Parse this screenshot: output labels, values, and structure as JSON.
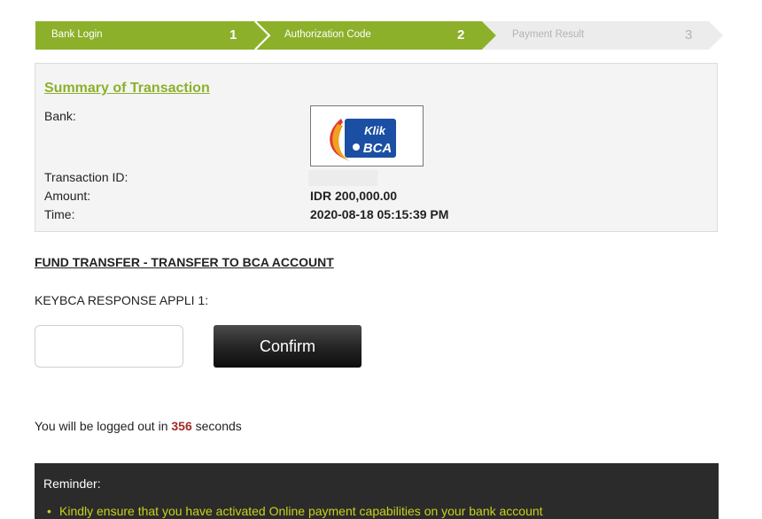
{
  "stepper": {
    "steps": [
      {
        "label": "Bank Login",
        "number": "1",
        "state": "done"
      },
      {
        "label": "Authorization Code",
        "number": "2",
        "state": "active"
      },
      {
        "label": "Payment Result",
        "number": "3",
        "state": "inactive"
      }
    ],
    "colors": {
      "active": "#8db02b",
      "inactive": "#ececec"
    }
  },
  "summary": {
    "title": "Summary of Transaction",
    "bank_label": "Bank:",
    "bank_logo_text_1": "Klik",
    "bank_logo_text_2": "BCA",
    "transaction_id_label": "Transaction ID:",
    "transaction_id_value": "",
    "amount_label": "Amount:",
    "amount_value": "IDR 200,000.00",
    "time_label": "Time:",
    "time_value": "2020-08-18 05:15:39 PM"
  },
  "transfer": {
    "section_title": "FUND TRANSFER - TRANSFER TO BCA ACCOUNT",
    "response_label": "KEYBCA RESPONSE APPLI 1:",
    "response_value": "",
    "confirm_label": "Confirm"
  },
  "session": {
    "logout_prefix": "You will be logged out in",
    "seconds_remaining": "356",
    "logout_suffix": "seconds"
  },
  "reminder": {
    "title": "Reminder:",
    "items": [
      "Kindly ensure that you have activated Online payment capabilities on your bank account"
    ]
  }
}
